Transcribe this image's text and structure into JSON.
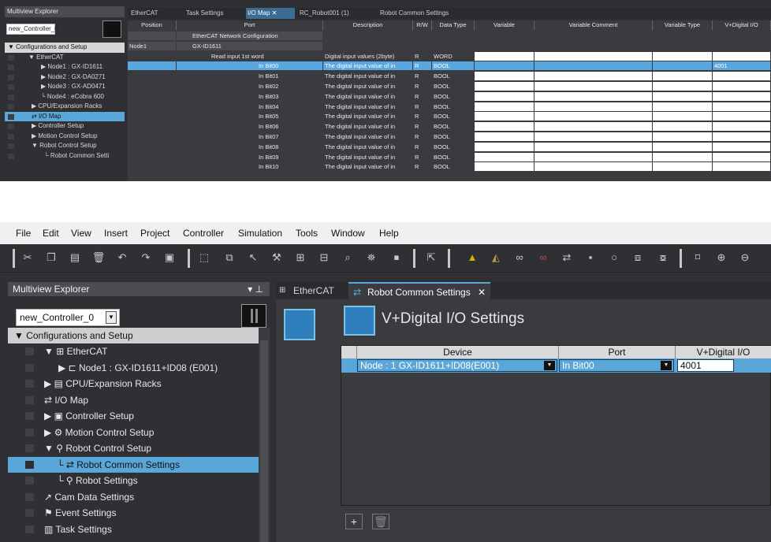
{
  "top_panel": {
    "explorer_title": "Multiview Explorer",
    "controller": "new_Controller_0",
    "tree": [
      "Configurations and Setup",
      "EtherCAT",
      "Node1 : GX-ID1611",
      "Node2 : GX-DA0271",
      "Node3 : GX-AD0471",
      "Node4 : eCobra 600",
      "CPU/Expansion Racks",
      "I/O Map",
      "Controller Setup",
      "Motion Control Setup",
      "Robot Control Setup",
      "Robot Common Setti"
    ],
    "tabs": [
      "EtherCAT",
      "Task Settings",
      "I/O Map",
      "RC_Robot001 (1)",
      "Robot Common Settings"
    ],
    "columns": [
      "Position",
      "Port",
      "Description",
      "R/W",
      "Data Type",
      "Variable",
      "Variable Comment",
      "Variable Type",
      "V+Digital I/O"
    ],
    "rows": [
      {
        "position": "",
        "port": "EtherCAT Network Configuration",
        "desc": "",
        "rw": "",
        "type": "",
        "vdio": ""
      },
      {
        "position": "Node1",
        "port": "GX-ID1611",
        "desc": "",
        "rw": "",
        "type": "",
        "vdio": ""
      },
      {
        "position": "",
        "port": "Read input 1st word",
        "desc": "Digital input values (2byte)",
        "rw": "R",
        "type": "WORD",
        "vdio": ""
      },
      {
        "position": "",
        "port": "In Bit00",
        "desc": "The digital input value of in",
        "rw": "R",
        "type": "BOOL",
        "vdio": "4001"
      },
      {
        "position": "",
        "port": "In Bit01",
        "desc": "The digital input value of in",
        "rw": "R",
        "type": "BOOL",
        "vdio": ""
      },
      {
        "position": "",
        "port": "In Bit02",
        "desc": "The digital input value of in",
        "rw": "R",
        "type": "BOOL",
        "vdio": ""
      },
      {
        "position": "",
        "port": "In Bit03",
        "desc": "The digital input value of in",
        "rw": "R",
        "type": "BOOL",
        "vdio": ""
      },
      {
        "position": "",
        "port": "In Bit04",
        "desc": "The digital input value of in",
        "rw": "R",
        "type": "BOOL",
        "vdio": ""
      },
      {
        "position": "",
        "port": "In Bit05",
        "desc": "The digital input value of in",
        "rw": "R",
        "type": "BOOL",
        "vdio": ""
      },
      {
        "position": "",
        "port": "In Bit06",
        "desc": "The digital input value of in",
        "rw": "R",
        "type": "BOOL",
        "vdio": ""
      },
      {
        "position": "",
        "port": "In Bit07",
        "desc": "The digital input value of in",
        "rw": "R",
        "type": "BOOL",
        "vdio": ""
      },
      {
        "position": "",
        "port": "In Bit08",
        "desc": "The digital input value of in",
        "rw": "R",
        "type": "BOOL",
        "vdio": ""
      },
      {
        "position": "",
        "port": "In Bit09",
        "desc": "The digital input value of in",
        "rw": "R",
        "type": "BOOL",
        "vdio": ""
      },
      {
        "position": "",
        "port": "In Bit10",
        "desc": "The digital input value of in",
        "rw": "R",
        "type": "BOOL",
        "vdio": ""
      }
    ]
  },
  "menubar": [
    "File",
    "Edit",
    "View",
    "Insert",
    "Project",
    "Controller",
    "Simulation",
    "Tools",
    "Window",
    "Help"
  ],
  "explorer": {
    "title": "Multiview Explorer",
    "controller": "new_Controller_0",
    "tree": [
      "Configurations and Setup",
      "EtherCAT",
      "Node1 : GX-ID1611+ID08 (E001)",
      "CPU/Expansion Racks",
      "I/O Map",
      "Controller Setup",
      "Motion Control Setup",
      "Robot Control Setup",
      "Robot Common Settings",
      "Robot Settings",
      "Cam Data Settings",
      "Event Settings",
      "Task Settings"
    ]
  },
  "editor": {
    "tabs": [
      "EtherCAT",
      "Robot Common Settings"
    ],
    "title": "V+Digital I/O Settings",
    "columns": [
      "Device",
      "Port",
      "V+Digital I/O"
    ],
    "row": {
      "device": "Node : 1 GX-ID1611+ID08(E001)",
      "port": "In Bit00",
      "vdio": "4001"
    }
  },
  "colors": {
    "accent": "#5aa6d9",
    "panel": "#2f3034"
  }
}
